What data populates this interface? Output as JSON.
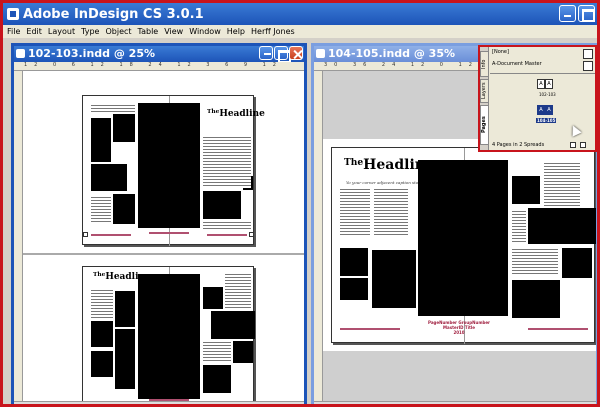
{
  "app": {
    "title": "Adobe InDesign CS 3.0.1"
  },
  "menubar": {
    "items": [
      "File",
      "Edit",
      "Layout",
      "Type",
      "Object",
      "Table",
      "View",
      "Window",
      "Help",
      "Herff Jones"
    ]
  },
  "documents": [
    {
      "title": "102-103.indd @ 25%",
      "ruler_labels": "12 0 6 12 18 24 12 3 6 9 12"
    },
    {
      "title": "104-105.indd @ 35%",
      "ruler_labels": "30 36 24 12 0 12 18"
    }
  ],
  "spread": {
    "headline_small": "The",
    "headline_big": "Headline",
    "deck": "Yo your corner adjacent caption story",
    "footer_line1": "PageNumber  GroupNumber",
    "footer_line2": "MasterID  Title",
    "footer_line3": "2010"
  },
  "pages_panel": {
    "tabs": [
      "Pages",
      "Layers",
      "Info"
    ],
    "none_label": "[None]",
    "master_label": "A-Document Master",
    "spread1_label": "102-103",
    "spread2_label": "104-105",
    "thumb_letter": "A",
    "status": "4 Pages in 2 Spreads"
  }
}
